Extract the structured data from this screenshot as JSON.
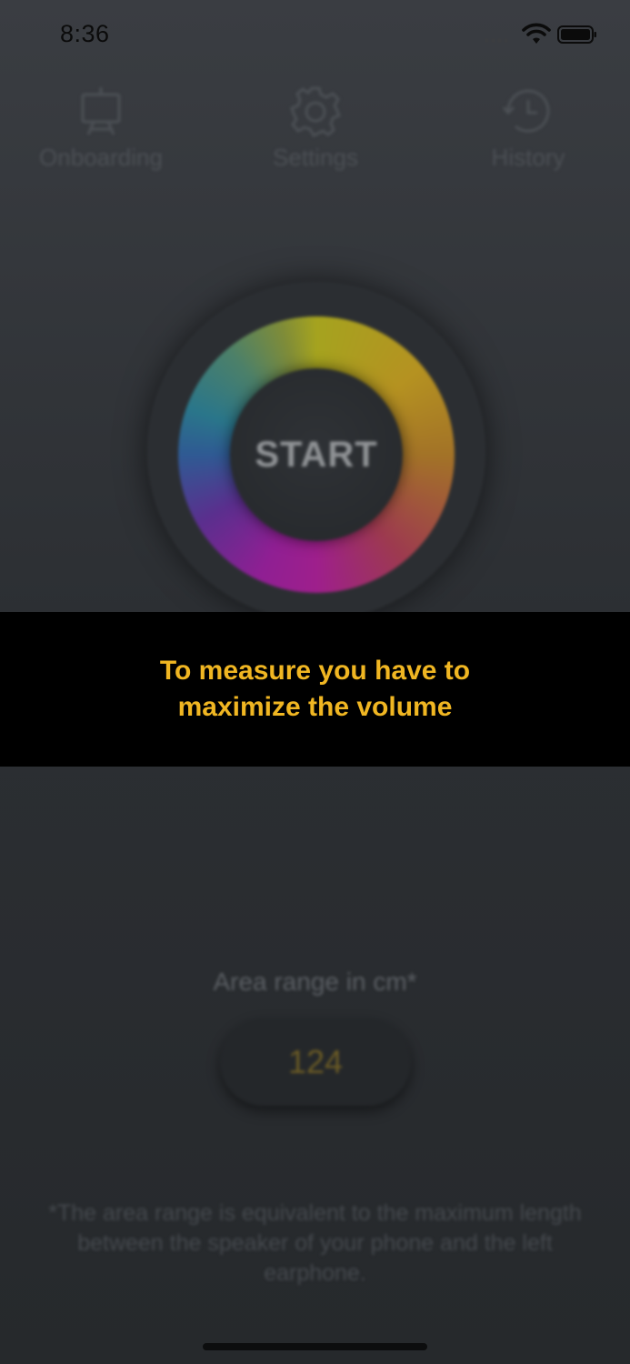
{
  "status_bar": {
    "time": "8:36"
  },
  "nav": {
    "items": [
      {
        "label": "Onboarding",
        "icon": "presentation-board-icon"
      },
      {
        "label": "Settings",
        "icon": "gear-icon"
      },
      {
        "label": "History",
        "icon": "history-clock-icon"
      }
    ]
  },
  "dial": {
    "label": "START"
  },
  "banner": {
    "message": "To measure you have to maximize the volume",
    "text_color": "#f0b622"
  },
  "area": {
    "label": "Area range in cm*",
    "value": "124",
    "footnote": "*The area range is equivalent to the maximum length between the speaker of your phone and the left earphone."
  }
}
